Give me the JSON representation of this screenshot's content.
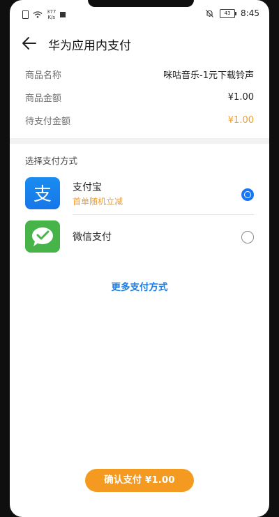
{
  "status_bar": {
    "speed_value": "377",
    "speed_unit": "K/s",
    "battery": "43",
    "time": "8:45"
  },
  "header": {
    "title": "华为应用内支付"
  },
  "goods": {
    "rows": [
      {
        "label": "商品名称",
        "value": "咪咕音乐-1元下载铃声"
      },
      {
        "label": "商品金额",
        "value": "¥1.00"
      },
      {
        "label": "待支付金额",
        "value": "¥1.00"
      }
    ]
  },
  "payment": {
    "section_title": "选择支付方式",
    "methods": [
      {
        "name": "支付宝",
        "promo": "首单随机立减",
        "selected": true,
        "icon": "alipay-icon",
        "color": "#1677ff"
      },
      {
        "name": "微信支付",
        "selected": false,
        "icon": "wechat-pay-icon",
        "color": "#47b449"
      }
    ],
    "more_label": "更多支付方式"
  },
  "confirm": {
    "label": "确认支付 ¥1.00"
  },
  "colors": {
    "accent_orange": "#f29d2e",
    "link_blue": "#1a7ee6",
    "radio_blue": "#1877f2"
  }
}
